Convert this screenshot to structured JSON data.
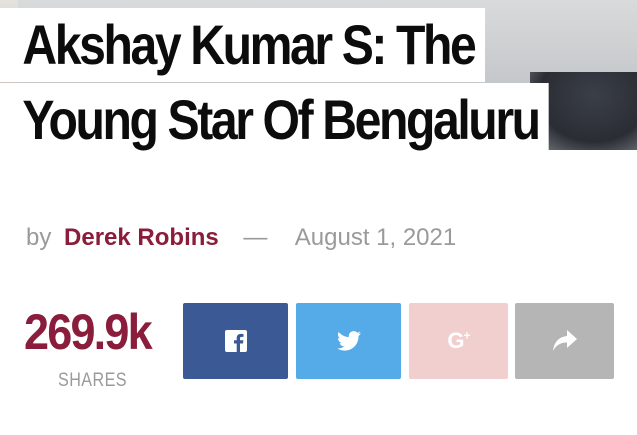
{
  "article": {
    "title_line1": "Akshay Kumar S: The",
    "title_line2": "Young Star Of Bengaluru",
    "by_label": "by",
    "author": "Derek Robins",
    "separator": "—",
    "date": "August 1, 2021"
  },
  "shares": {
    "count": "269.9k",
    "label": "SHARES"
  },
  "share_buttons": [
    {
      "name": "facebook",
      "icon": "facebook-icon",
      "color": "#3b5a95"
    },
    {
      "name": "twitter",
      "icon": "twitter-icon",
      "color": "#55abe7"
    },
    {
      "name": "google-plus",
      "icon": "google-plus-icon",
      "glyph": "G",
      "superscript": "+",
      "color": "#f2cfcf"
    },
    {
      "name": "share",
      "icon": "share-arrow-icon",
      "color": "#b5b5b5"
    }
  ],
  "colors": {
    "accent": "#8a1d3b",
    "muted": "#9a9a9a",
    "title": "#0c0c0c"
  }
}
